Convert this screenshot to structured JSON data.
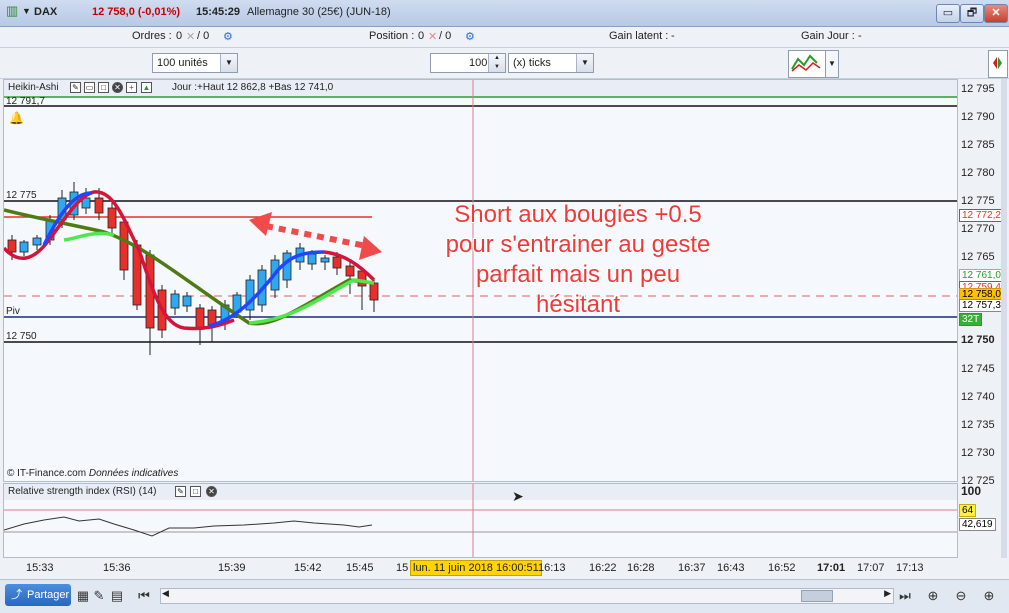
{
  "titlebar": {
    "instrument": "DAX",
    "price_change": "12 758,0 (-0,01%)",
    "time": "15:45:29",
    "contract": "Allemagne 30 (25€) (JUN-18)",
    "win_buttons": [
      "▭",
      "🗗",
      "✕"
    ]
  },
  "infobar": {
    "orders_label": "Ordres :",
    "orders_value": "0",
    "orders_value2": "/ 0",
    "position_label": "Position :",
    "position_value": "0",
    "position_value2": "/ 0",
    "gain_latent_label": "Gain latent :",
    "gain_latent_value": "-",
    "gain_jour_label": "Gain Jour :",
    "gain_jour_value": "-"
  },
  "toolbar": {
    "quantity": "100 unités",
    "step_value": "100",
    "step_unit": "(x) ticks"
  },
  "chart_panel": {
    "indicator_name": "Heikin-Ashi",
    "day_info": "Jour :+Haut 12 862,8 +Bas 12 741,0",
    "level_top": "12 791,7",
    "level_12775": "12 775",
    "level_piv": "Piv",
    "level_12750": "12 750",
    "copyright": "© IT-Finance.com",
    "copyright_note": "Données indicatives"
  },
  "annotation": {
    "lines": [
      "Short aux bougies +0.5",
      "pour s'entrainer au geste",
      "parfait mais un peu",
      "hésitant"
    ]
  },
  "rsi_panel": {
    "title": "Relative strength index (RSI) (14)",
    "axis_100": "100",
    "level_64": "64",
    "value": "42,619"
  },
  "price_axis": {
    "labels": [
      "12 795",
      "12 790",
      "12 785",
      "12 780",
      "12 775",
      "12 770",
      "12 765",
      "12 750",
      "12 745",
      "12 740",
      "12 735",
      "12 730",
      "12 725"
    ],
    "tag_red": "12 772,2",
    "tag_green": "12 761,0",
    "tag_red2": "12 759,4",
    "tag_orange": "12 758,0",
    "tag_last": "12 757,3",
    "tag_32t": "32T"
  },
  "time_axis": {
    "labels": [
      "15:33",
      "15:36",
      "15:39",
      "15:42",
      "15:45",
      "15",
      "16:13",
      "16:22",
      "16:28",
      "16:37",
      "16:43",
      "16:52",
      "17:01",
      "17:07",
      "17:13"
    ],
    "cursor_label": "lun. 11 juin 2018 16:00:51"
  },
  "bottombar": {
    "share_label": "Partager"
  },
  "colors": {
    "bull_candle": "#2ea8f0",
    "bear_candle": "#e8302a",
    "ma_up": "#2146ff",
    "ma_down": "#d4143a",
    "ma2_up": "#4ee84e",
    "ma2_down": "#4f7a14",
    "annotation": "#f03a3a"
  }
}
